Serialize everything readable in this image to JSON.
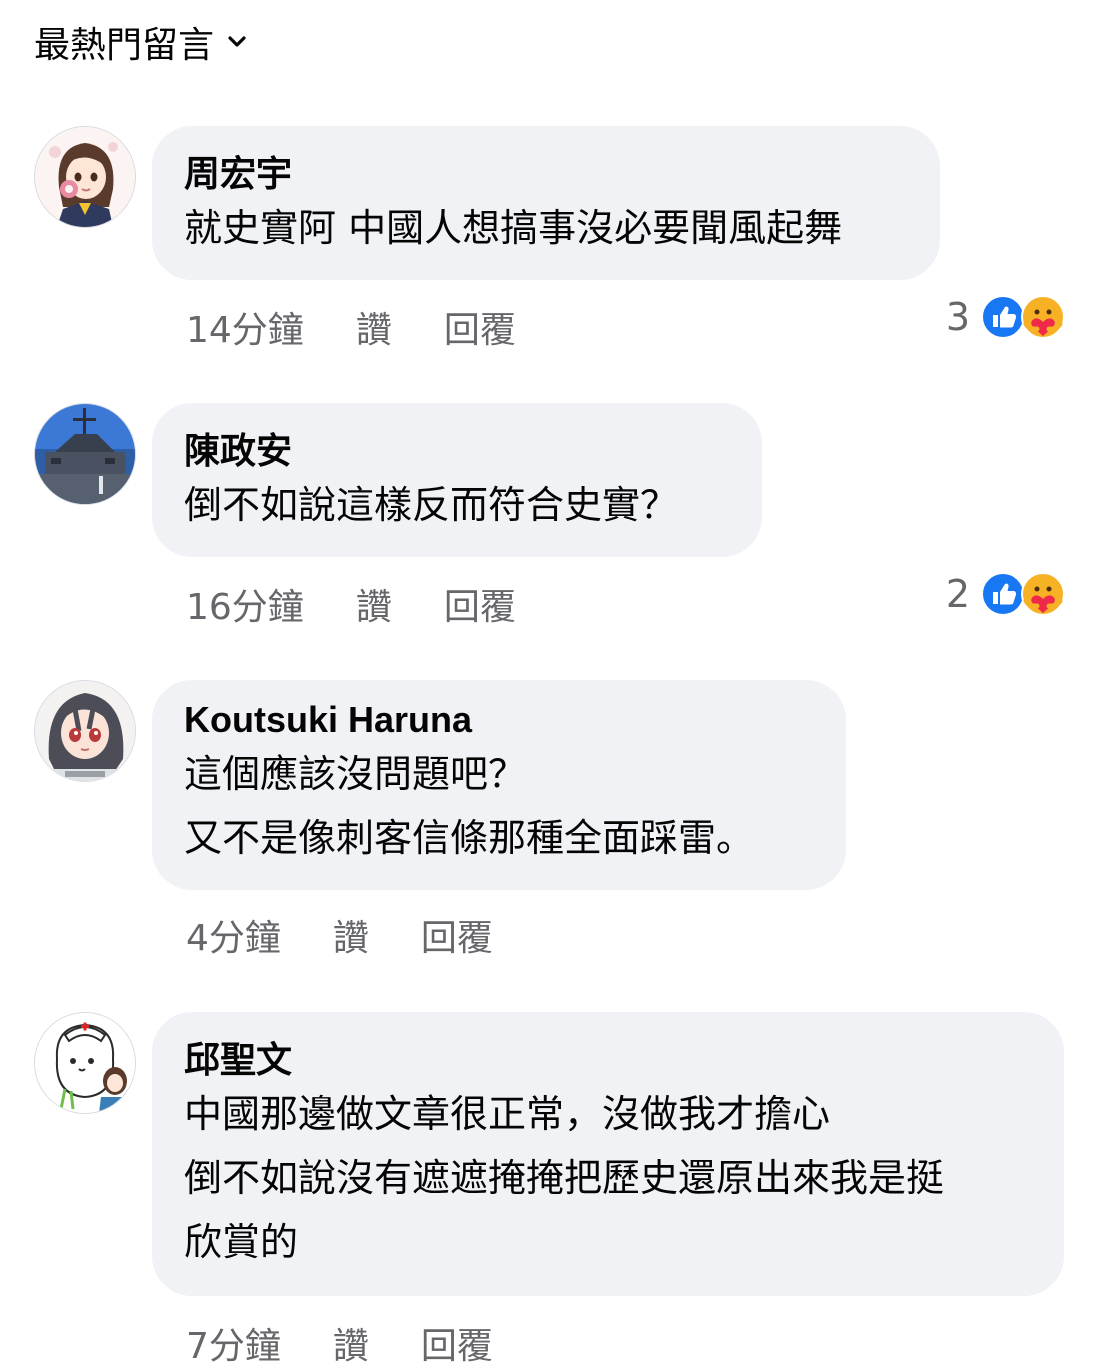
{
  "header": {
    "sort_label": "最熱門留言"
  },
  "comments": [
    {
      "author": "周宏宇",
      "text": "就史實阿 中國人想搞事沒必要聞風起舞",
      "time": "14分鐘",
      "like_label": "讚",
      "reply_label": "回覆",
      "reaction_count": "3"
    },
    {
      "author": "陳政安",
      "text": "倒不如說這樣反而符合史實？",
      "time": "16分鐘",
      "like_label": "讚",
      "reply_label": "回覆",
      "reaction_count": "2"
    },
    {
      "author": "Koutsuki Haruna",
      "text": "這個應該沒問題吧？\n又不是像刺客信條那種全面踩雷。",
      "time": "4分鐘",
      "like_label": "讚",
      "reply_label": "回覆"
    },
    {
      "author": "邱聖文",
      "text": "中國那邊做文章很正常，沒做我才擔心\n倒不如說沒有遮遮掩掩把歷史還原出來我是挺\n欣賞的",
      "time": "7分鐘",
      "like_label": "讚",
      "reply_label": "回覆"
    }
  ],
  "colors": {
    "bubble": "#f0f2f5",
    "meta_text": "#65676b",
    "like_blue": "#1877f2",
    "care_yellow": "#f7b125"
  },
  "icons": {
    "sort": "chevron-down-icon",
    "like_reaction": "like-reaction-icon",
    "care_reaction": "care-reaction-icon"
  }
}
